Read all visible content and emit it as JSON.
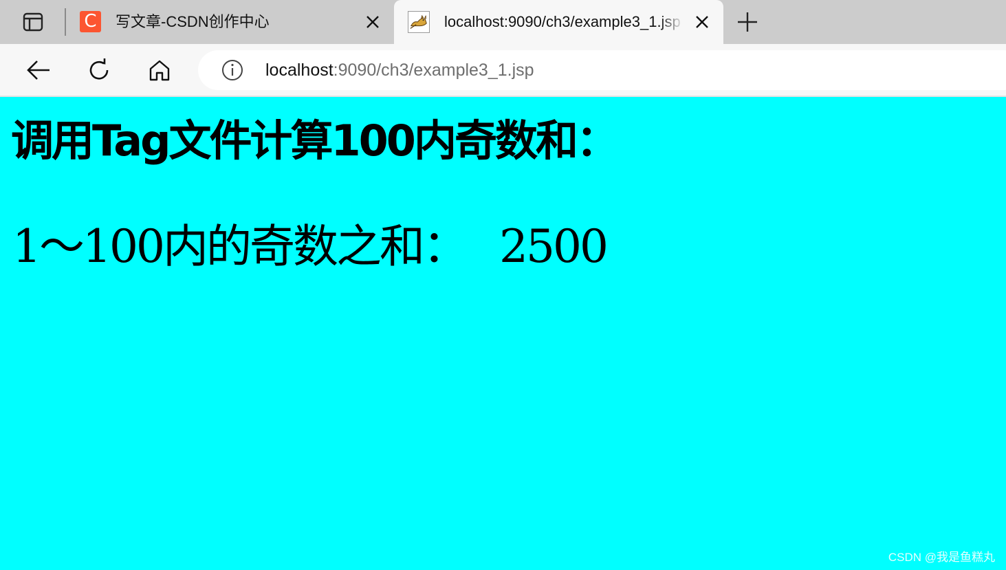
{
  "browser": {
    "tabs": [
      {
        "title": "写文章-CSDN创作中心",
        "favicon_letter": "C",
        "active": false
      },
      {
        "title": "localhost:9090/ch3/example3_1.jsp",
        "active": true
      }
    ],
    "address_bar": {
      "url_host": "localhost",
      "url_rest": ":9090/ch3/example3_1.jsp"
    },
    "icons": {
      "tab_actions": "tab-actions-icon",
      "new_tab": "plus-icon",
      "back": "arrow-left-icon",
      "reload": "reload-icon",
      "home": "home-icon",
      "site_info": "info-icon",
      "close": "close-icon"
    }
  },
  "page": {
    "background": "#00ffff",
    "heading": "调用Tag文件计算100内奇数和：",
    "result_label": "1～100内的奇数之和：",
    "result_value": "2500"
  },
  "watermark": "CSDN @我是鱼糕丸"
}
